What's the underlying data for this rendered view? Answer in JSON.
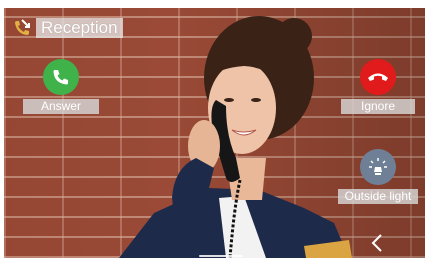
{
  "header": {
    "title": "Reception",
    "icon": "missed-call-icon"
  },
  "actions": {
    "answer": {
      "label": "Answer",
      "icon": "phone-icon",
      "color": "#3fb34a"
    },
    "ignore": {
      "label": "Ignore",
      "icon": "hang-up-icon",
      "color": "#e11b1b"
    },
    "outside_light": {
      "label": "Outside light",
      "icon": "light-bulb-icon",
      "color": "#6f8096"
    }
  },
  "navigation": {
    "back": "back-chevron-icon"
  }
}
